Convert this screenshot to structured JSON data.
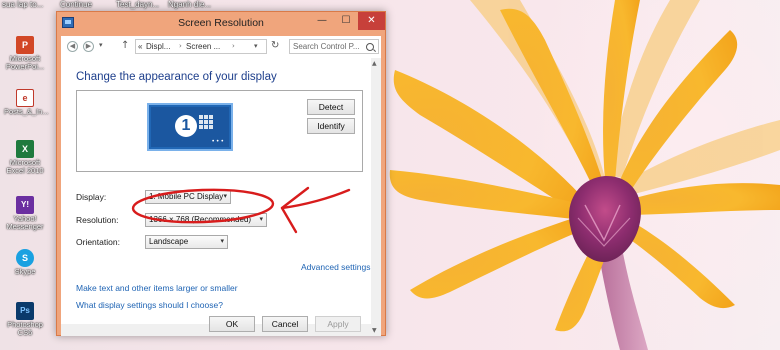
{
  "desktop": {
    "top_labels": [
      "sua lap to...",
      "Continue",
      "Test_dayn...",
      "Nganh die..."
    ],
    "icons": [
      {
        "label": "Microsoft\nPowerPoi...",
        "glyph": "P",
        "icon": "powerpoint-icon",
        "color": "#d24726"
      },
      {
        "label": "Posts_&_In...",
        "glyph": "e",
        "icon": "pdf-document-icon",
        "color": "#c0392b"
      },
      {
        "label": "Microsoft\nExcel 2010",
        "glyph": "X",
        "icon": "excel-icon",
        "color": "#1f7a3e"
      },
      {
        "label": "Yahoo!\nMessenger",
        "glyph": "Y!",
        "icon": "yahoo-messenger-icon",
        "color": "#6b2fa0"
      },
      {
        "label": "Skype",
        "glyph": "S",
        "icon": "skype-icon",
        "color": "#1aa1e1"
      },
      {
        "label": "Photoshop\nCS6",
        "glyph": "Ps",
        "icon": "photoshop-icon",
        "color": "#0a3a6b"
      }
    ]
  },
  "window": {
    "title": "Screen Resolution",
    "minimize": "—",
    "maximize": "☐",
    "close": "✕",
    "address": {
      "crumb_overflow": "«",
      "crumbs": [
        "Displ...",
        "Screen ..."
      ],
      "search_placeholder": "Search Control P..."
    },
    "heading": "Change the appearance of your display",
    "monitor_number": "1",
    "buttons": {
      "detect": "Detect",
      "identify": "Identify",
      "ok": "OK",
      "cancel": "Cancel",
      "apply": "Apply"
    },
    "settings": {
      "display_label": "Display:",
      "display_value": "1. Mobile PC Display",
      "resolution_label": "Resolution:",
      "resolution_value": "1366 × 768 (Recommended)",
      "orientation_label": "Orientation:",
      "orientation_value": "Landscape"
    },
    "links": {
      "advanced": "Advanced settings",
      "larger": "Make text and other items larger or smaller",
      "which": "What display settings should I choose?"
    }
  },
  "colors": {
    "window_frame": "#f0a57c",
    "link": "#1f64b4",
    "heading": "#1e3f8c",
    "annotation": "#d81c1c",
    "petal": "#f7a822",
    "flower_center": "#8b2a6b"
  }
}
